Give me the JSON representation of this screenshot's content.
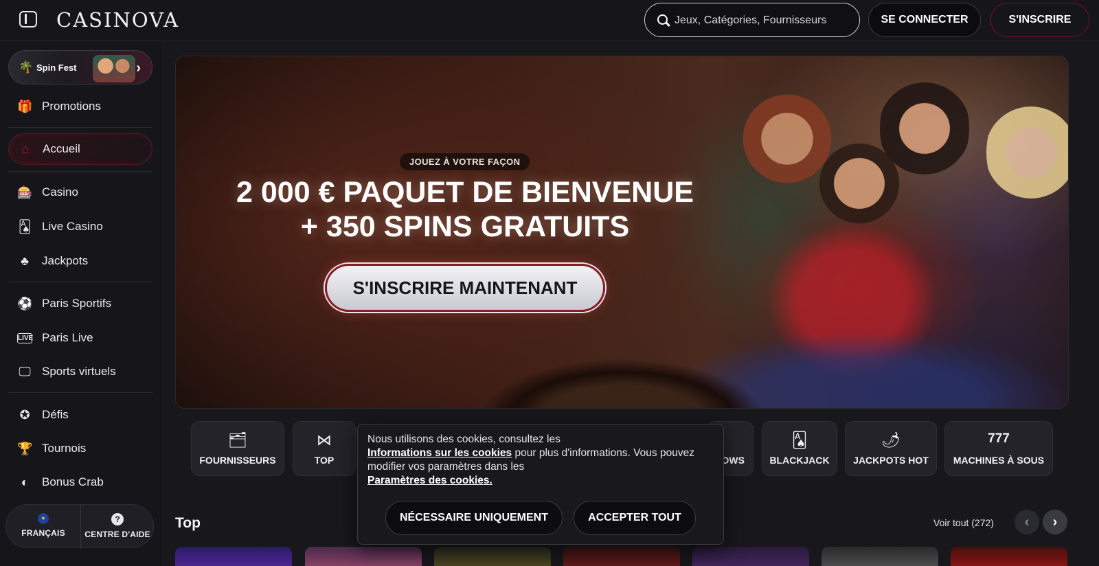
{
  "header": {
    "logo": "CASINOVA",
    "search_placeholder": "Jeux, Catégories, Fournisseurs",
    "login_label": "SE CONNECTER",
    "signup_label": "S'INSCRIRE"
  },
  "sidebar": {
    "spinfest_label": "Spin Fest",
    "items": [
      {
        "label": "Promotions",
        "icon": "gift-icon"
      },
      {
        "label": "Accueil",
        "icon": "home-icon"
      },
      {
        "label": "Casino",
        "icon": "slot-machine-icon"
      },
      {
        "label": "Live Casino",
        "icon": "live-casino-icon"
      },
      {
        "label": "Jackpots",
        "icon": "clover-icon"
      },
      {
        "label": "Paris Sportifs",
        "icon": "soccer-ball-icon"
      },
      {
        "label": "Paris Live",
        "icon": "live-badge-icon"
      },
      {
        "label": "Sports virtuels",
        "icon": "virtual-sports-icon"
      },
      {
        "label": "Défis",
        "icon": "medal-icon"
      },
      {
        "label": "Tournois",
        "icon": "trophy-icon"
      },
      {
        "label": "Bonus Crab",
        "icon": "crab-icon"
      }
    ],
    "language_label": "FRANÇAIS",
    "help_label": "CENTRE D'AIDE"
  },
  "hero": {
    "tag": "JOUEZ À VOTRE FAÇON",
    "title_line1": "2 000 € PAQUET DE BIENVENUE",
    "title_line2": "+ 350 SPINS GRATUITS",
    "cta_label": "S'INSCRIRE MAINTENANT"
  },
  "categories": [
    {
      "label": "FOURNISSEURS",
      "icon": "providers-icon"
    },
    {
      "label": "TOP",
      "icon": "bow-tie-icon"
    },
    {
      "label": "OWS",
      "icon": "shows-icon"
    },
    {
      "label": "BLACKJACK",
      "icon": "cards-icon"
    },
    {
      "label": "JACKPOTS HOT",
      "icon": "hot-pepper-icon"
    },
    {
      "label": "MACHINES À SOUS",
      "icon": "777-icon"
    }
  ],
  "section": {
    "title": "Top",
    "see_all": "Voir tout (272)"
  },
  "cookie": {
    "text_1": "Nous utilisons des cookies, consultez les",
    "link_1": "Informations sur les cookies",
    "text_2": "pour plus d'informations. Vous pouvez modifier vos paramètres dans les",
    "link_2": "Paramètres des cookies.",
    "necessary_label": "NÉCESSAIRE UNIQUEMENT",
    "accept_label": "ACCEPTER TOUT"
  }
}
